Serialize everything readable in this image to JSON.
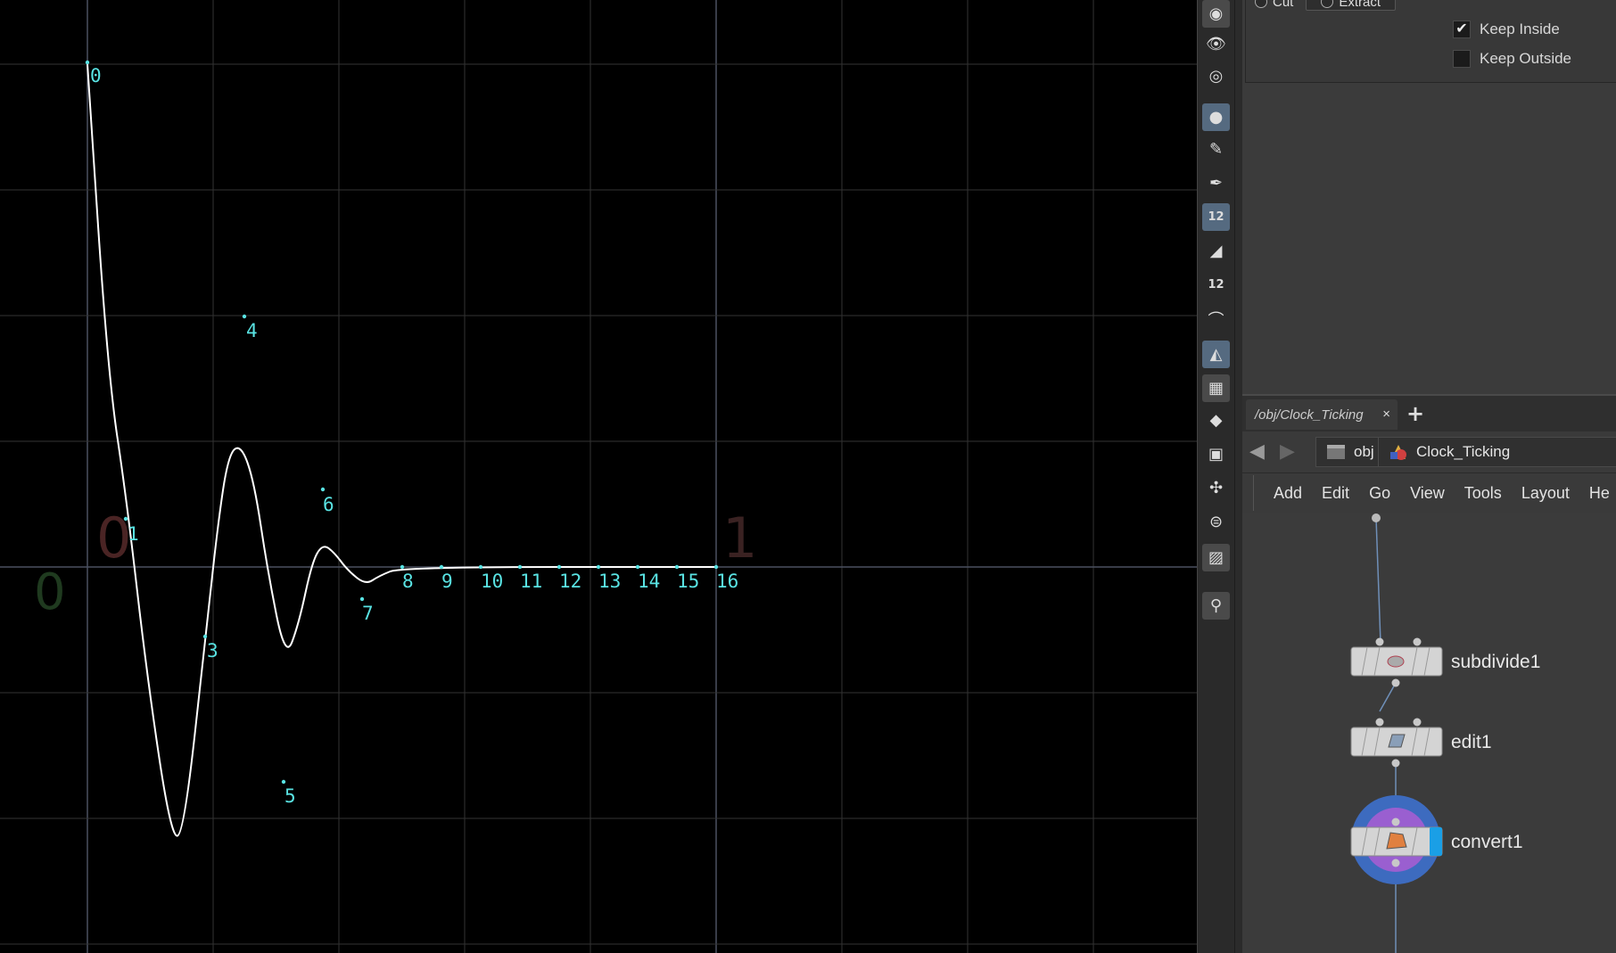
{
  "viewport": {
    "grid_origin_label": "0",
    "grid_x_label_left": "0",
    "grid_x_label_right": "1",
    "point_labels": [
      "0",
      "1",
      "3",
      "4",
      "5",
      "6",
      "7",
      "8",
      "9",
      "10",
      "11",
      "12",
      "13",
      "14",
      "15",
      "16"
    ]
  },
  "toolbar": {
    "tools": [
      "object-select-icon",
      "view-icon",
      "camera-view-icon",
      "point-icon",
      "brush-icon",
      "pen-icon",
      "point-numbers-icon",
      "paint-icon",
      "primitive-numbers-icon",
      "curve-icon",
      "shaded-icon",
      "checker-icon",
      "diamond-icon",
      "uv-icon",
      "axis-icon",
      "layout-icon",
      "background-icon",
      "pin-icon"
    ]
  },
  "params": {
    "mode_cut": "Cut",
    "mode_extract": "Extract",
    "keep_inside": "Keep Inside",
    "keep_outside": "Keep Outside",
    "keep_inside_checked": true,
    "keep_outside_checked": false
  },
  "network": {
    "tab_label": "/obj/Clock_Ticking",
    "tab_close": "×",
    "add_tab": "+",
    "crumb_obj": "obj",
    "crumb_node": "Clock_Ticking",
    "menu": [
      "Add",
      "Edit",
      "Go",
      "View",
      "Tools",
      "Layout",
      "He"
    ],
    "nodes": [
      {
        "name": "subdivide1",
        "icon": "subdivide-icon"
      },
      {
        "name": "edit1",
        "icon": "edit-icon"
      },
      {
        "name": "convert1",
        "icon": "convert-icon",
        "display": true
      }
    ],
    "colors": {
      "display_ring": "#3d6bbf",
      "selected_ring": "#9a5fd0",
      "display_flag": "#1a9fe6"
    }
  }
}
